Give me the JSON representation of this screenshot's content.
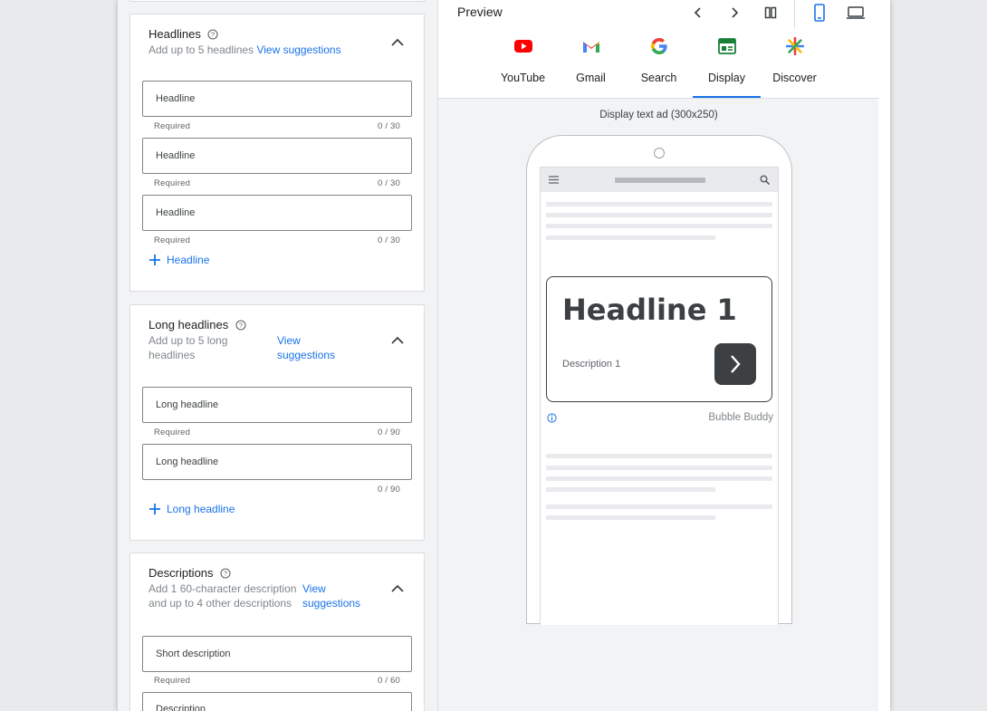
{
  "headlines": {
    "title": "Headlines",
    "subtitle": "Add up to 5 headlines",
    "suggestions_link": "View suggestions",
    "fields": [
      {
        "placeholder": "Headline",
        "helper": "Required",
        "counter": "0 / 30"
      },
      {
        "placeholder": "Headline",
        "helper": "Required",
        "counter": "0 / 30"
      },
      {
        "placeholder": "Headline",
        "helper": "Required",
        "counter": "0 / 30"
      }
    ],
    "add_label": "Headline"
  },
  "long_headlines": {
    "title": "Long headlines",
    "subtitle_line1": "Add up to 5 long",
    "subtitle_line2": "headlines",
    "suggestions_line1": "View",
    "suggestions_line2": "suggestions",
    "fields": [
      {
        "placeholder": "Long headline",
        "helper": "Required",
        "counter": "0 / 90"
      },
      {
        "placeholder": "Long headline",
        "helper": "",
        "counter": "0 / 90"
      }
    ],
    "add_label": "Long headline"
  },
  "descriptions": {
    "title": "Descriptions",
    "subtitle_line1": "Add 1 60-character description",
    "subtitle_line2": "and up to 4 other descriptions",
    "suggestions_line1": "View",
    "suggestions_line2": "suggestions",
    "fields": [
      {
        "placeholder": "Short description",
        "helper": "Required",
        "counter": "0 / 60"
      },
      {
        "placeholder": "Description",
        "helper": "",
        "counter": ""
      }
    ]
  },
  "preview": {
    "title": "Preview",
    "tabs": [
      {
        "label": "YouTube",
        "icon": "youtube-icon"
      },
      {
        "label": "Gmail",
        "icon": "gmail-icon"
      },
      {
        "label": "Search",
        "icon": "google-icon"
      },
      {
        "label": "Display",
        "icon": "display-icon"
      },
      {
        "label": "Discover",
        "icon": "discover-icon"
      }
    ],
    "active_tab": "Display",
    "ad_format": "Display text ad (300x250)",
    "ad": {
      "headline": "Headline 1",
      "description": "Description 1",
      "brand": "Bubble Buddy"
    }
  },
  "colors": {
    "accent": "#1a73e8",
    "youtube_red": "#ff0000",
    "display_green": "#188038"
  }
}
